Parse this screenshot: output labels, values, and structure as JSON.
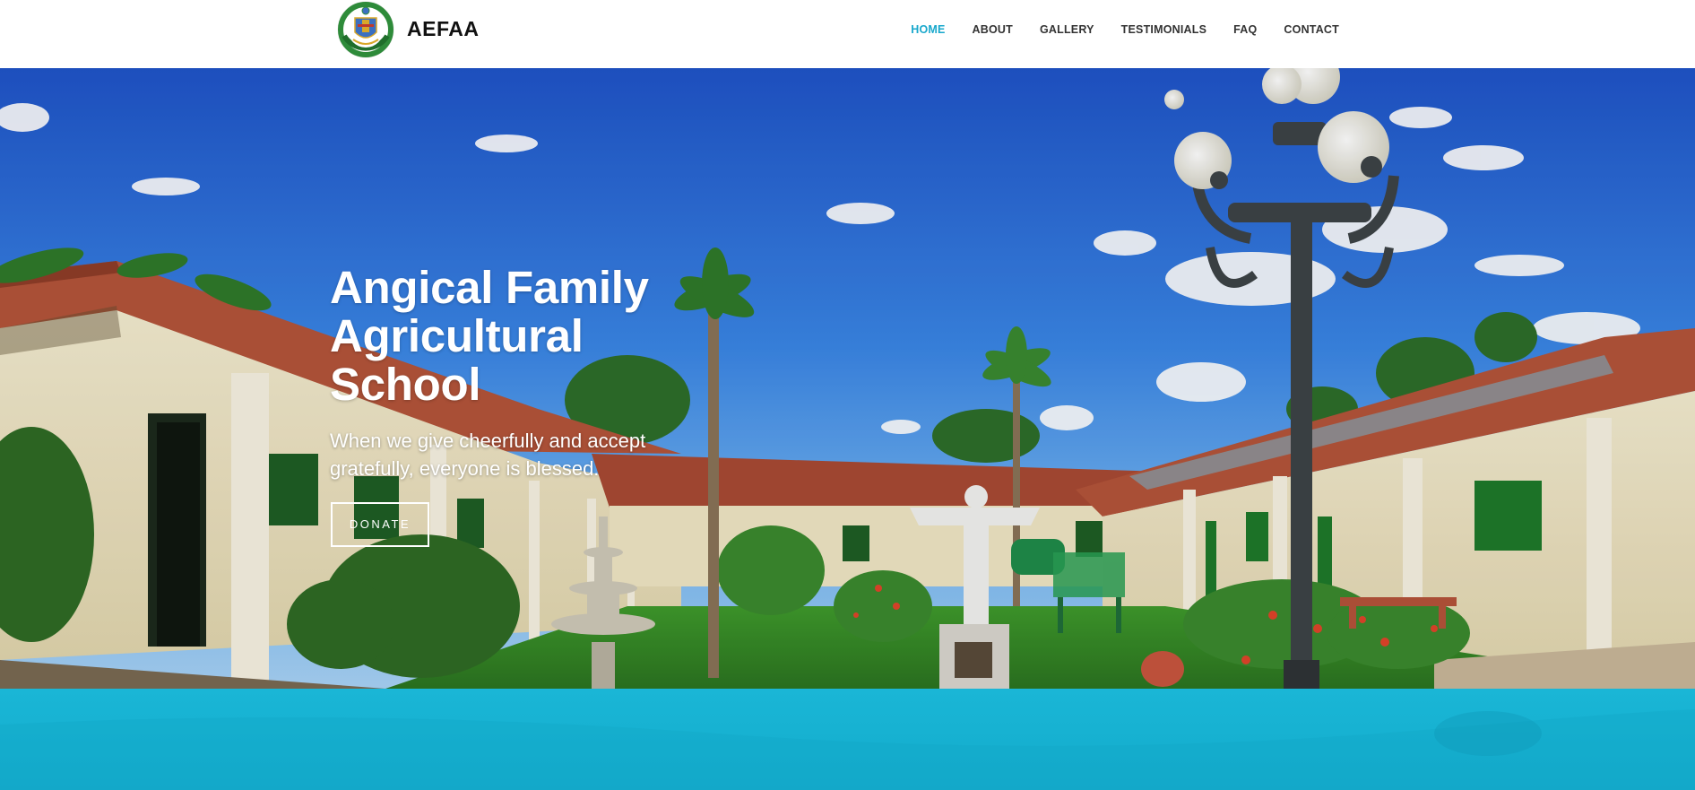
{
  "header": {
    "brand_name": "AEFAA",
    "logo_icon": "school-crest-logo-icon",
    "nav": [
      {
        "label": "HOME",
        "active": true
      },
      {
        "label": "ABOUT",
        "active": false
      },
      {
        "label": "GALLERY",
        "active": false
      },
      {
        "label": "TESTIMONIALS",
        "active": false
      },
      {
        "label": "FAQ",
        "active": false
      },
      {
        "label": "CONTACT",
        "active": false
      }
    ]
  },
  "hero": {
    "title_line1": "Angical Family",
    "title_line2": "Agricultural",
    "title_line3": "School",
    "subtitle": "When we give cheerfully and accept gratefully, everyone is blessed.",
    "donate_label": "DONATE",
    "background": "school-courtyard-photo"
  },
  "colors": {
    "accent": "#19a8cc",
    "teal_band": "#17b2d2",
    "nav_text": "#333333"
  }
}
